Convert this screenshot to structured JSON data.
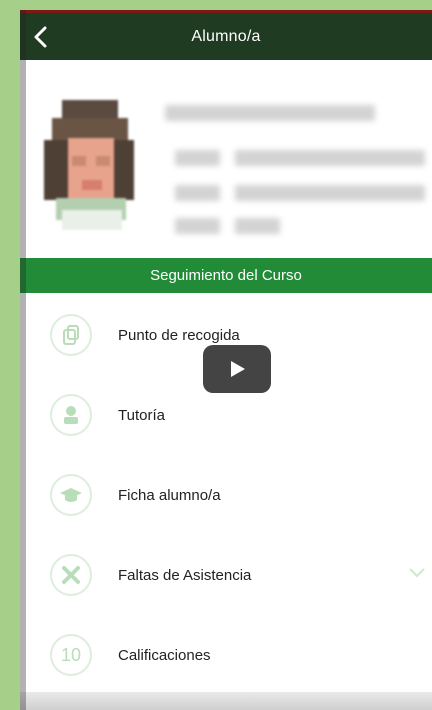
{
  "header": {
    "title": "Alumno/a"
  },
  "section": {
    "title": "Seguimiento del Curso"
  },
  "menu": {
    "items": [
      {
        "label": "Punto de recogida",
        "icon": "document-icon"
      },
      {
        "label": "Tutoría",
        "icon": "user-icon"
      },
      {
        "label": "Ficha alumno/a",
        "icon": "graduation-cap-icon"
      },
      {
        "label": "Faltas de Asistencia",
        "icon": "cross-icon"
      },
      {
        "label": "Calificaciones",
        "icon": "number-ten-icon"
      }
    ],
    "icon_text_10": "10"
  },
  "colors": {
    "header_bg": "#1f3b22",
    "section_bg": "#228b38",
    "icon_green": "#b9ddb9",
    "page_bg": "#a6d08a"
  }
}
